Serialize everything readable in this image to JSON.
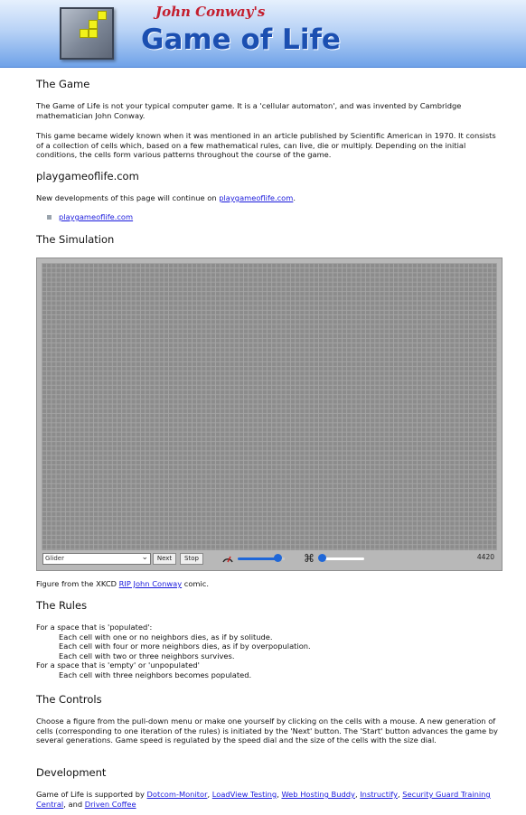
{
  "header": {
    "subtitle": "John Conway's",
    "title": "Game of Life"
  },
  "game": {
    "heading": "The Game",
    "p1": "The Game of Life is not your typical computer game. It is a 'cellular automaton', and was invented by Cambridge mathematician John Conway.",
    "p2": "This game became widely known when it was mentioned in an article published by Scientific American in 1970. It consists of a collection of cells which, based on a few mathematical rules, can live, die or multiply. Depending on the initial conditions, the cells form various patterns throughout the course of the game."
  },
  "playgame": {
    "heading": "playgameoflife.com",
    "text_before": "New developments of this page will continue on ",
    "link": "playgameoflife.com",
    "text_after": ".",
    "bullet_link": "playgameoflife.com"
  },
  "simulation": {
    "heading": "The Simulation",
    "pattern_select": "Glider",
    "next_label": "Next",
    "stop_label": "Stop",
    "speed_level": 0.85,
    "size_level": 0.05,
    "generation": "4420",
    "caption_before": "Figure from the XKCD ",
    "caption_link": "RIP John Conway",
    "caption_after": " comic."
  },
  "rules": {
    "heading": "The Rules",
    "populated_intro": "For a space that is 'populated':",
    "populated": [
      "Each cell with one or no neighbors dies, as if by solitude.",
      "Each cell with four or more neighbors dies, as if by overpopulation.",
      "Each cell with two or three neighbors survives."
    ],
    "empty_intro": "For a space that is 'empty' or 'unpopulated'",
    "empty": [
      "Each cell with three neighbors becomes populated."
    ]
  },
  "controls": {
    "heading": "The Controls",
    "text": "Choose a figure from the pull-down menu or make one yourself by clicking on the cells with a mouse. A new generation of cells (corresponding to one iteration of the rules) is initiated by the 'Next' button. The 'Start' button advances the game by several generations. Game speed is regulated by the speed dial and the size of the cells with the size dial."
  },
  "development": {
    "heading": "Development",
    "intro": "Game of Life is supported by ",
    "sponsors": [
      "Dotcom-Monitor",
      "LoadView Testing",
      "Web Hosting Buddy",
      "Instructify",
      "Security Guard Training Central",
      "Driven Coffee"
    ],
    "sep_comma": ", ",
    "sep_and": ", and "
  }
}
